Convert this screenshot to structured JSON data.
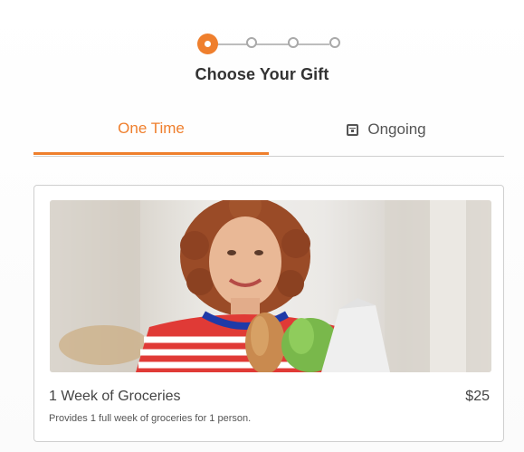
{
  "stepper": {
    "current_step": 1,
    "total_steps": 4,
    "accent_color": "#ef7f2d"
  },
  "title": "Choose Your Gift",
  "tabs": [
    {
      "label": "One Time",
      "active": true,
      "icon": ""
    },
    {
      "label": "Ongoing",
      "active": false,
      "icon": "calendar-icon"
    }
  ],
  "gift_card": {
    "image": "woman-holding-groceries-photo",
    "name": "1 Week of Groceries",
    "price": "$25",
    "description": "Provides 1 full week of groceries for 1 person."
  }
}
